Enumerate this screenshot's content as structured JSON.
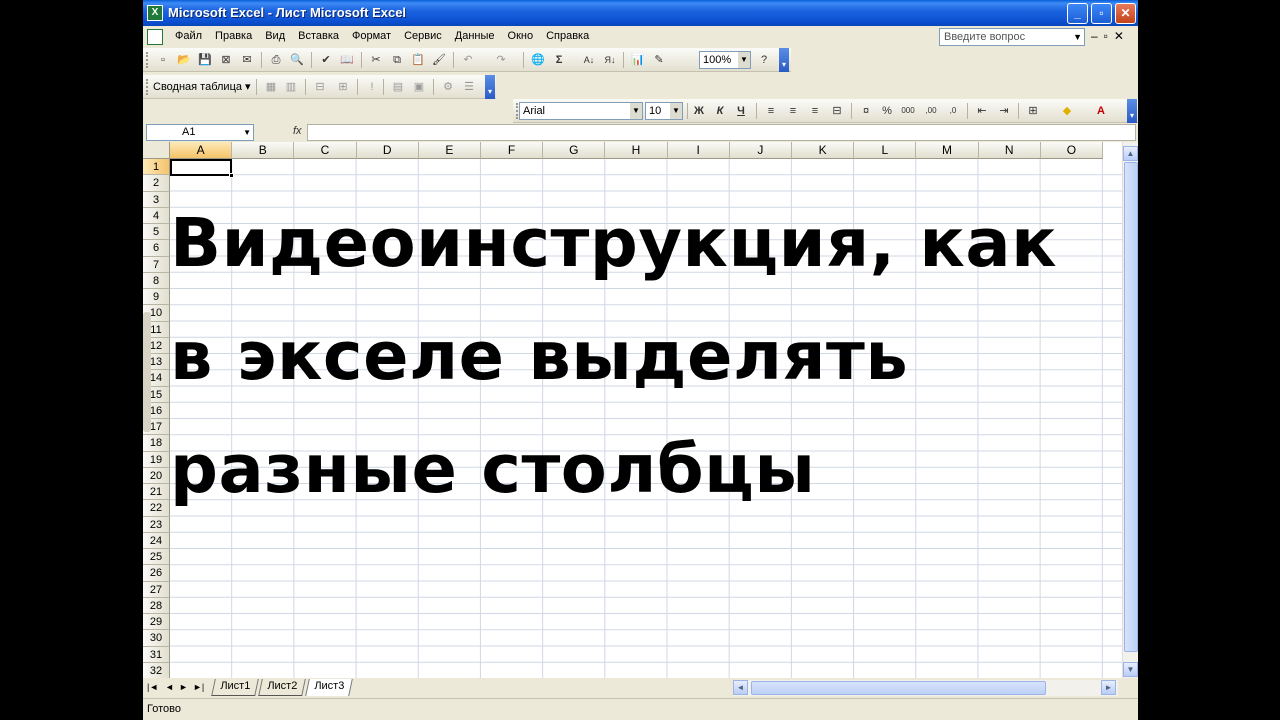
{
  "window": {
    "title": "Microsoft Excel - Лист Microsoft Excel"
  },
  "menu": {
    "items": [
      "Файл",
      "Правка",
      "Вид",
      "Вставка",
      "Формат",
      "Сервис",
      "Данные",
      "Окно",
      "Справка"
    ],
    "help_placeholder": "Введите вопрос"
  },
  "toolbar": {
    "zoom": "100%"
  },
  "pivot_toolbar": {
    "label": "Сводная таблица ▾"
  },
  "format_toolbar": {
    "font": "Arial",
    "size": "10",
    "bold": "Ж",
    "italic": "К",
    "underline": "Ч"
  },
  "formula_bar": {
    "name_box": "A1",
    "fx": "fx"
  },
  "grid": {
    "columns": [
      "A",
      "B",
      "C",
      "D",
      "E",
      "F",
      "G",
      "H",
      "I",
      "J",
      "K",
      "L",
      "M",
      "N",
      "O"
    ],
    "rows": [
      "1",
      "2",
      "3",
      "4",
      "5",
      "6",
      "7",
      "8",
      "9",
      "10",
      "11",
      "12",
      "13",
      "14",
      "15",
      "16",
      "17",
      "18",
      "19",
      "20",
      "21",
      "22",
      "23",
      "24",
      "25",
      "26",
      "27",
      "28",
      "29",
      "30",
      "31",
      "32"
    ],
    "selected_cell": "A1"
  },
  "overlay_text": [
    "Видеоинструкция, как",
    "в экселе выделять",
    "разные столбцы"
  ],
  "sheets": [
    "Лист1",
    "Лист2",
    "Лист3"
  ],
  "active_sheet": "Лист3",
  "status": "Готово"
}
